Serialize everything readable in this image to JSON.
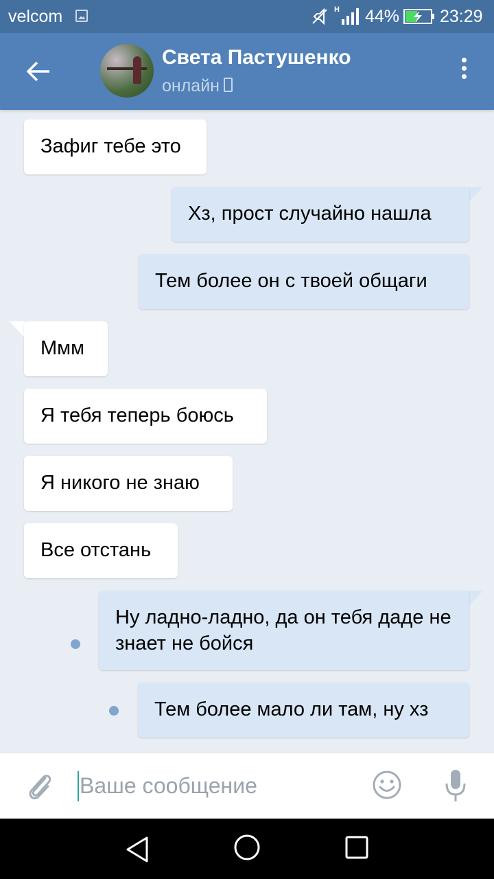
{
  "status_bar": {
    "carrier": "velcom",
    "network_type": "H",
    "battery_percent": "44%",
    "time": "23:29"
  },
  "header": {
    "contact_name": "Света Пастушенко",
    "contact_status": "онлайн"
  },
  "messages": [
    {
      "direction": "in",
      "text": "Зафиг тебе это"
    },
    {
      "direction": "out",
      "text": "Хз, прост случайно нашла"
    },
    {
      "direction": "out",
      "text": "Тем более он с твоей общаги"
    },
    {
      "direction": "in",
      "text": "Ммм"
    },
    {
      "direction": "in",
      "text": "Я тебя теперь боюсь"
    },
    {
      "direction": "in",
      "text": "Я никого не знаю"
    },
    {
      "direction": "in",
      "text": "Все отстань"
    },
    {
      "direction": "out",
      "text": "Ну ладно-ладно, да он тебя даде не знает не бойся",
      "unread": true
    },
    {
      "direction": "out",
      "text": "Тем более мало ли там, ну хз",
      "unread": true
    }
  ],
  "composer": {
    "placeholder": "Ваше сообщение",
    "value": ""
  },
  "colors": {
    "header": "#5181b8",
    "status_bar": "#4470a0",
    "background": "#e9eef4",
    "outgoing_bubble": "#d8e6f5",
    "incoming_bubble": "#ffffff",
    "unread_dot": "#80a6d0"
  },
  "icons": [
    "back-arrow-icon",
    "more-vertical-icon",
    "phone-icon",
    "attach-icon",
    "emoji-icon",
    "mic-icon",
    "nav-back-icon",
    "nav-home-icon",
    "nav-recent-icon"
  ]
}
